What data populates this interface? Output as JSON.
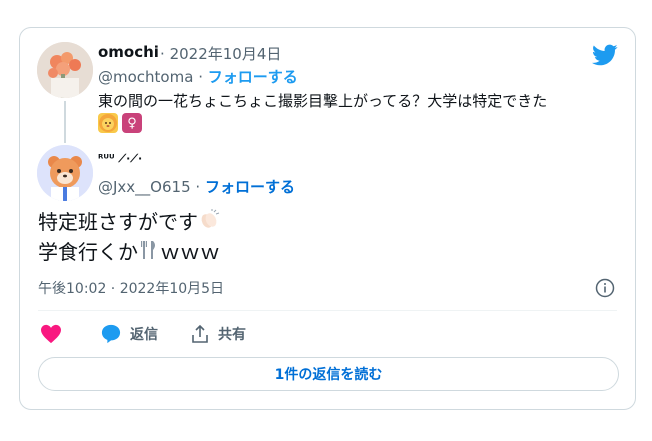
{
  "tweet1": {
    "name": "omochi",
    "date_sep": "·",
    "date": "2022年10月4日",
    "handle": "@mochtoma",
    "follow_sep": "·",
    "follow": "フォローする",
    "text": "東の間の一花ちょこちょこ撮影目撃上がってる？大学は特定できた",
    "emoji1": "🦁",
    "emoji2": "♀"
  },
  "tweet2": {
    "name": "ᴿᵁᵁ ⟋·⟋·",
    "handle": "@Jxx__O615",
    "follow_sep": "·",
    "follow": "フォローする",
    "text_line1": "特定班さすがです",
    "text_line2": "学食行くか",
    "text_line2_tail": "ｗｗｗ",
    "timestamp": "午後10:02 · 2022年10月5日"
  },
  "actions": {
    "reply": "返信",
    "share": "共有"
  },
  "readmore": "1件の返信を読む",
  "colors": {
    "blue": "#1d9bf0",
    "link": "#006fd6",
    "heart": "#f91880",
    "muted": "#536471"
  }
}
